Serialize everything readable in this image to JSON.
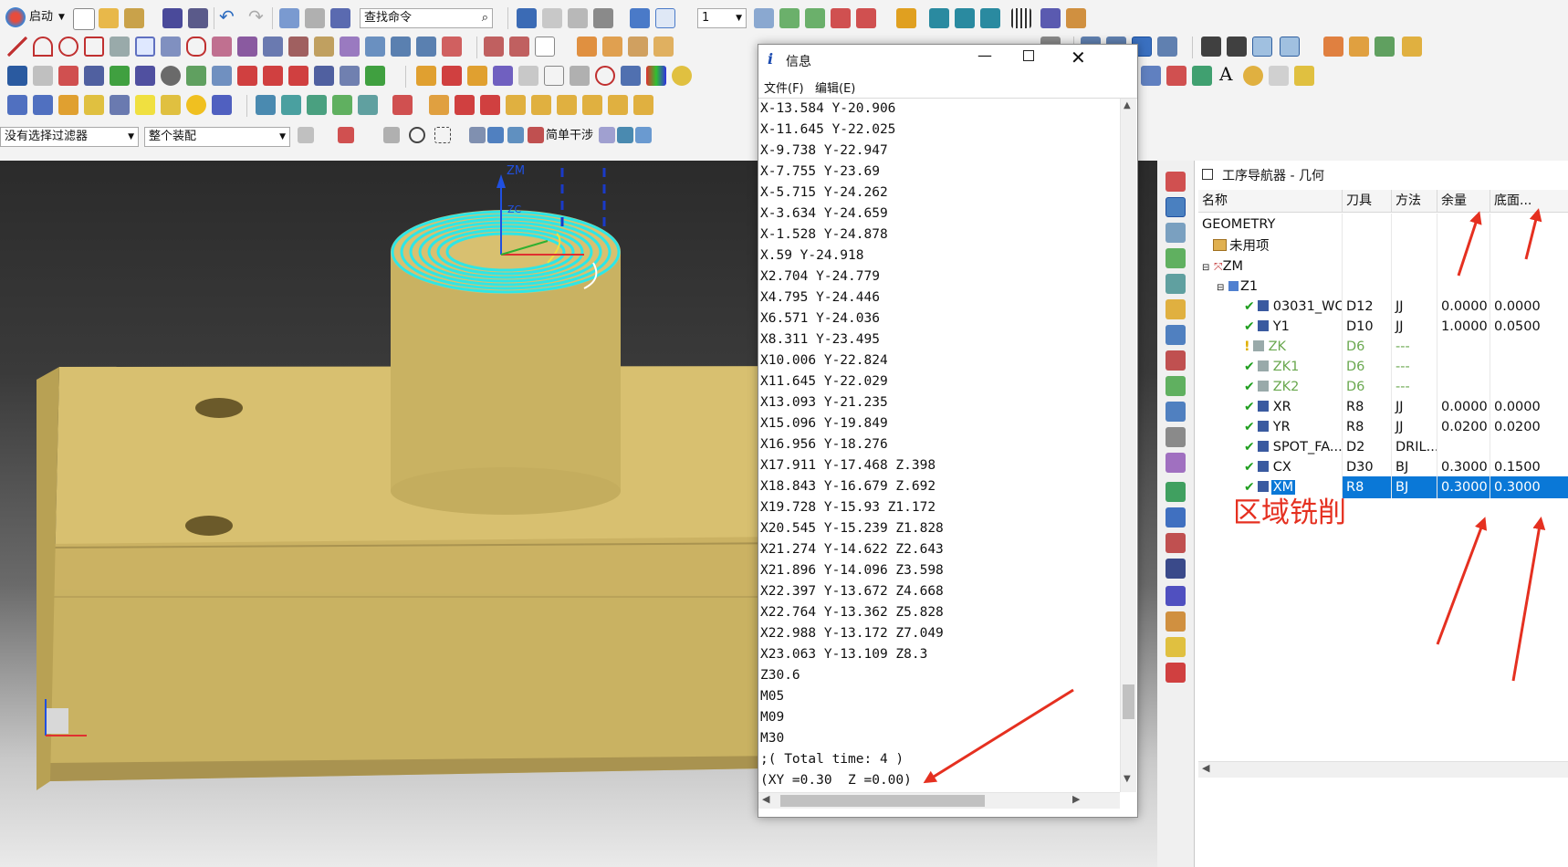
{
  "toolbar": {
    "start_label": "启动",
    "search_value": "查找命令",
    "number_combo": "1",
    "filter_combo": "没有选择过滤器",
    "assembly_combo": "整个装配",
    "simple_interference": "简单干涉"
  },
  "viewport": {
    "axis_zm": "ZM",
    "axis_zc": "ZC"
  },
  "info_window": {
    "title": "信息",
    "title_icon": "info-icon",
    "menu": [
      "文件(F)",
      "编辑(E)"
    ],
    "lines": [
      "X-13.584 Y-20.906",
      "X-11.645 Y-22.025",
      "X-9.738 Y-22.947",
      "X-7.755 Y-23.69",
      "X-5.715 Y-24.262",
      "X-3.634 Y-24.659",
      "X-1.528 Y-24.878",
      "X.59 Y-24.918",
      "X2.704 Y-24.779",
      "X4.795 Y-24.446",
      "X6.571 Y-24.036",
      "X8.311 Y-23.495",
      "X10.006 Y-22.824",
      "X11.645 Y-22.029",
      "X13.093 Y-21.235",
      "X15.096 Y-19.849",
      "X16.956 Y-18.276",
      "X17.911 Y-17.468 Z.398",
      "X18.843 Y-16.679 Z.692",
      "X19.728 Y-15.93 Z1.172",
      "X20.545 Y-15.239 Z1.828",
      "X21.274 Y-14.622 Z2.643",
      "X21.896 Y-14.096 Z3.598",
      "X22.397 Y-13.672 Z4.668",
      "X22.764 Y-13.362 Z5.828",
      "X22.988 Y-13.172 Z7.049",
      "X23.063 Y-13.109 Z8.3",
      "Z30.6",
      "M05",
      "M09",
      "M30",
      ";( Total time: 4 )",
      "(XY =0.30  Z =0.00)"
    ]
  },
  "navigator": {
    "title": "工序导航器 - 几何",
    "columns": [
      "名称",
      "刀具",
      "方法",
      "余量",
      "底面..."
    ],
    "root": "GEOMETRY",
    "unused": "未用项",
    "zm": "ZM",
    "z1": "Z1",
    "ops": [
      {
        "name": "03031_WC",
        "tool": "D12",
        "method": "JJ",
        "stock": "0.0000",
        "floor": "0.0000",
        "status": "ok",
        "grayed": false
      },
      {
        "name": "Y1",
        "tool": "D10",
        "method": "JJ",
        "stock": "1.0000",
        "floor": "0.0500",
        "status": "ok",
        "grayed": false
      },
      {
        "name": "ZK",
        "tool": "D6",
        "method": "---",
        "stock": "",
        "floor": "",
        "status": "warn",
        "grayed": true
      },
      {
        "name": "ZK1",
        "tool": "D6",
        "method": "---",
        "stock": "",
        "floor": "",
        "status": "ok",
        "grayed": true
      },
      {
        "name": "ZK2",
        "tool": "D6",
        "method": "---",
        "stock": "",
        "floor": "",
        "status": "ok",
        "grayed": true
      },
      {
        "name": "XR",
        "tool": "R8",
        "method": "JJ",
        "stock": "0.0000",
        "floor": "0.0000",
        "status": "ok",
        "grayed": false
      },
      {
        "name": "YR",
        "tool": "R8",
        "method": "JJ",
        "stock": "0.0200",
        "floor": "0.0200",
        "status": "ok",
        "grayed": false
      },
      {
        "name": "SPOT_FA...",
        "tool": "D2",
        "method": "DRIL...",
        "stock": "",
        "floor": "",
        "status": "ok",
        "grayed": false
      },
      {
        "name": "CX",
        "tool": "D30",
        "method": "BJ",
        "stock": "0.3000",
        "floor": "0.1500",
        "status": "ok",
        "grayed": false
      },
      {
        "name": "XM",
        "tool": "R8",
        "method": "BJ",
        "stock": "0.3000",
        "floor": "0.3000",
        "status": "ok",
        "grayed": false,
        "selected": true
      }
    ]
  },
  "annotation": {
    "label": "区域铣削",
    "color": "#e53020"
  },
  "colors": {
    "part": "#d8c070",
    "toolpath": "#2ee6e6",
    "selection": "#0a78d7"
  }
}
